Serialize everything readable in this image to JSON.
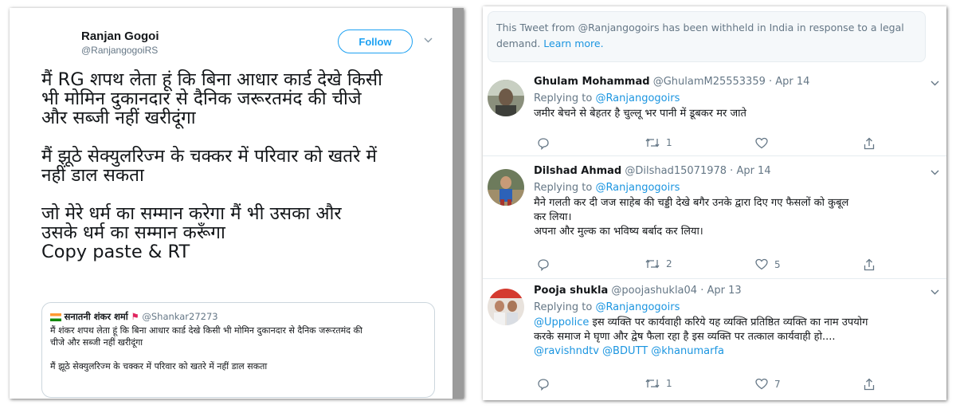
{
  "left_tweet": {
    "author_name": "Ranjan Gogoi",
    "author_handle": "@RanjangogoiRS",
    "follow_label": "Follow",
    "text_lines": [
      "मैं RG शपथ लेता हूं कि बिना आधार कार्ड देखे किसी",
      "भी मोमिन दुकानदार से दैनिक जरूरतमंद की चीजे",
      "और सब्जी नहीं खरीदूंगा",
      "मैं झूठे सेक्युलरिज्म के चक्कर में परिवार को खतरे में",
      "नहीं डाल सकता",
      "जो मेरे धर्म का सम्मान करेगा मैं भी उसका और",
      "उसके धर्म का सम्मान करूँगा",
      "Copy paste & RT"
    ],
    "quote": {
      "author_name": "सनातनी शंकर शर्मा",
      "flag": "⚑",
      "author_handle": "@Shankar27273",
      "text_lines": [
        "मैं शंकर शपथ लेता हूं कि बिना आधार कार्ड देखे किसी भी मोमिन दुकानदार से दैनिक जरूरतमंद की",
        "चीजे और सब्जी नहीं खरीदूंगा",
        "मैं झूठे सेक्युलरिज्म के चक्कर में परिवार को खतरे में नहीं डाल सकता"
      ]
    }
  },
  "withheld_notice": {
    "text": "This Tweet from @Ranjangogoirs has been withheld in India in response to a legal demand.",
    "link": "Learn more."
  },
  "replying_label": "Replying to",
  "replies": [
    {
      "name": "Ghulam Mohammad",
      "handle": "@GhulamM25553359",
      "date": "Apr 14",
      "replying_to": "@Ranjangogoirs",
      "text_lines": [
        "जमीर बेचने से बेहतर है चुल्लू भर पानी में डूबकर मर जाते"
      ],
      "retweets": "1",
      "likes": ""
    },
    {
      "name": "Dilshad Ahmad",
      "handle": "@Dilshad15071978",
      "date": "Apr 14",
      "replying_to": "@Ranjangogoirs",
      "text_lines": [
        "मैने गलती कर दी जज साहेब की चड्डी देखे बगैर उनके द्वारा दिए गए फैसलों को कुबूल",
        "कर लिया।",
        "अपना और मुल्क का भविष्य बर्बाद कर लिया।"
      ],
      "retweets": "2",
      "likes": "5"
    },
    {
      "name": "Pooja shukla",
      "handle": "@poojashukla04",
      "date": "Apr 13",
      "replying_to": "@Ranjangogoirs",
      "mention_start": "@Uppolice",
      "text_lines": [
        " इस व्यक्ति पर कार्यवाही करिये  यह व्यक्ति प्रतिष्ठित व्यक्ति का नाम उपयोग",
        "करके समाज मे घृणा और द्वेष फैला रहा है इस व्यक्ति पर तत्काल कार्यवाही हो...."
      ],
      "mentions_end": "@ravishndtv @BDUTT @khanumarfa",
      "retweets": "1",
      "likes": "7"
    }
  ],
  "colors": {
    "link": "#1b95e0",
    "follow": "#1da1f2",
    "muted": "#657786",
    "text": "#14171a"
  },
  "icons": [
    "reply-icon",
    "retweet-icon",
    "like-icon",
    "share-icon",
    "chevron-down-icon",
    "flag-icon"
  ]
}
